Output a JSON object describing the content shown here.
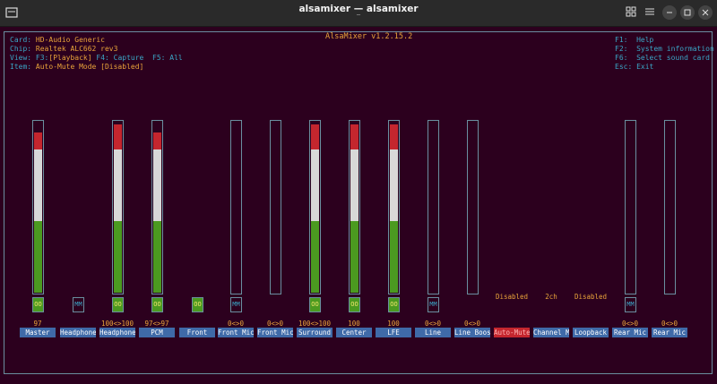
{
  "window": {
    "title": "alsamixer — alsamixer",
    "subtitle": "‾"
  },
  "header": {
    "title": "AlsaMixer v1.2.15.2"
  },
  "info": {
    "card_label": "Card:",
    "card_value": "HD-Audio Generic",
    "chip_label": "Chip:",
    "chip_value": "Realtek ALC662 rev3",
    "view_label": "View:",
    "view_f3": "F3:",
    "view_playback": "[Playback]",
    "view_f4": "F4: Capture",
    "view_f5": "F5: All",
    "item_label": "Item:",
    "item_value": "Auto-Mute Mode [Disabled]"
  },
  "keys": {
    "f1_key": "F1:",
    "f1_text": "Help",
    "f2_key": "F2:",
    "f2_text": "System information",
    "f6_key": "F6:",
    "f6_text": "Select sound card",
    "esc_key": "Esc:",
    "esc_text": "Exit"
  },
  "controls": [
    {
      "name": "Master",
      "value": "97",
      "mute": "OO",
      "level": 0.97
    },
    {
      "name": "Headphone",
      "value": "",
      "mute": "MM",
      "level": null
    },
    {
      "name": "Headphone",
      "value": "100<>100",
      "mute": "OO",
      "level": 1.0
    },
    {
      "name": "PCM",
      "value": "97<>97",
      "mute": "OO",
      "level": 0.97
    },
    {
      "name": "Front",
      "value": "",
      "mute": "OO",
      "level": null
    },
    {
      "name": "Front Mic",
      "value": "0<>0",
      "mute": "MM",
      "level": 0
    },
    {
      "name": "Front Mic",
      "value": "0<>0",
      "mute": "",
      "level": 0
    },
    {
      "name": "Surround",
      "value": "100<>100",
      "mute": "OO",
      "level": 1.0
    },
    {
      "name": "Center",
      "value": "100",
      "mute": "OO",
      "level": 1.0
    },
    {
      "name": "LFE",
      "value": "100",
      "mute": "OO",
      "level": 1.0
    },
    {
      "name": "Line",
      "value": "0<>0",
      "mute": "MM",
      "level": 0
    },
    {
      "name": "Line Boos",
      "value": "0<>0",
      "mute": "",
      "level": 0
    },
    {
      "name": "Auto-Mute",
      "value": "Disabled",
      "mute": "",
      "level": null,
      "selected": true
    },
    {
      "name": "Channel M",
      "value": "2ch",
      "mute": "",
      "level": null
    },
    {
      "name": "Loopback",
      "value": "Disabled",
      "mute": "",
      "level": null
    },
    {
      "name": "Rear Mic",
      "value": "0<>0",
      "mute": "MM",
      "level": 0
    },
    {
      "name": "Rear Mic",
      "value": "0<>0",
      "mute": "",
      "level": 0
    }
  ],
  "colors": {
    "background": "#2c001e",
    "accent": "#e8a33a",
    "label": "#3aa6c6",
    "green": "#4b9a20",
    "red": "#c4262e",
    "name_bg": "#3f6aa8"
  }
}
